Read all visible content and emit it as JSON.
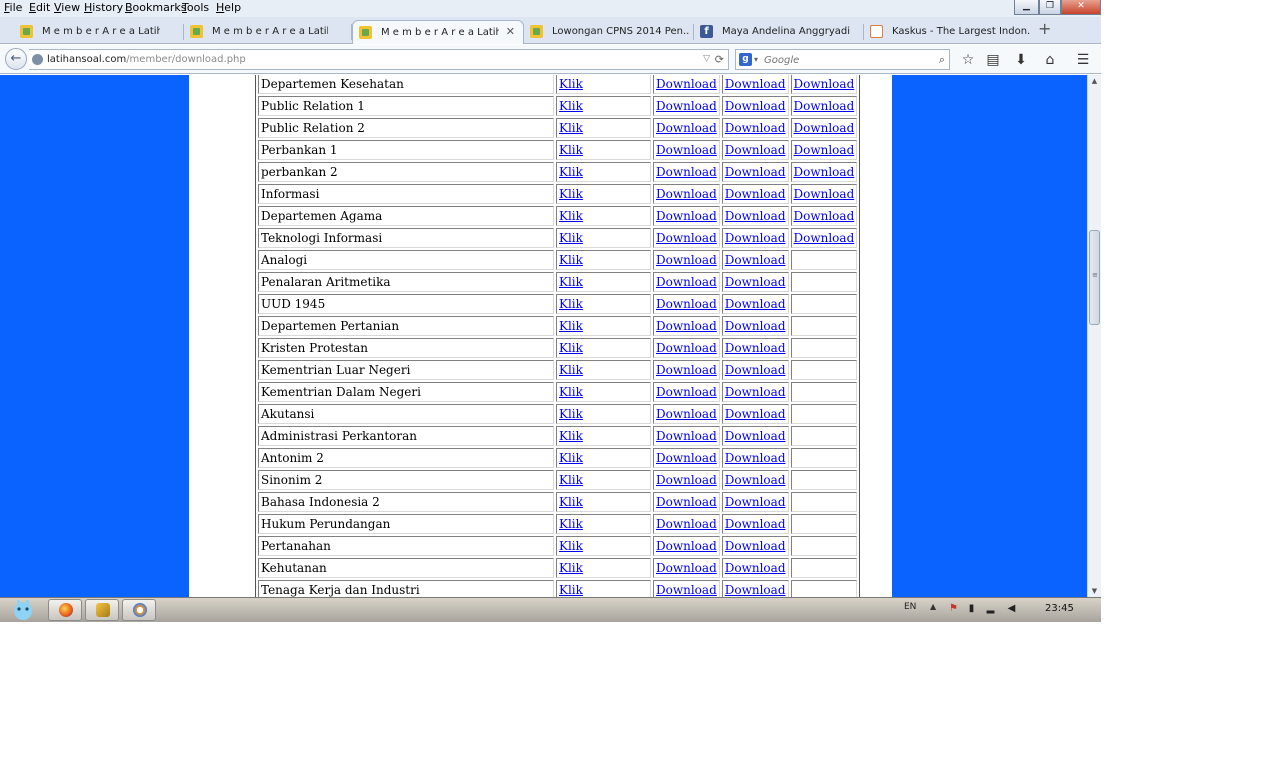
{
  "menubar": {
    "items": [
      "File",
      "Edit",
      "View",
      "History",
      "Bookmarks",
      "Tools",
      "Help"
    ]
  },
  "window_controls": {
    "minimize": "▁",
    "restore": "❐",
    "close": "✕"
  },
  "tabs": [
    {
      "title": "M e m b e r A r e a  Latihan...",
      "favicon": "latihansoal-icon"
    },
    {
      "title": "M e m b e r A r e a  Latihan...",
      "favicon": "latihansoal-icon"
    },
    {
      "title": "M e m b e r A r e a  Latihan...",
      "favicon": "latihansoal-icon",
      "active": true
    },
    {
      "title": "Lowongan CPNS 2014 Pen...",
      "favicon": "latihansoal-icon"
    },
    {
      "title": "Maya Andelina Anggryadi",
      "favicon": "facebook-icon"
    },
    {
      "title": "Kaskus - The Largest Indon...",
      "favicon": "kaskus-icon"
    }
  ],
  "new_tab": "+",
  "navbar": {
    "url_host": "latihansoal.com",
    "url_path": "/member/download.php",
    "search_placeholder": "Google",
    "back": "←",
    "reload": "⟳",
    "dropdown": "▽"
  },
  "colors": {
    "page_background": "#0a63ff",
    "link": "#0000ee"
  },
  "table": {
    "rows": [
      {
        "name": "Departemen Kesehatan",
        "klik": "Klik",
        "d1": "Download",
        "d2": "Download",
        "d3": "Download"
      },
      {
        "name": "Public Relation 1",
        "klik": "Klik",
        "d1": "Download",
        "d2": "Download",
        "d3": "Download"
      },
      {
        "name": "Public Relation 2",
        "klik": "Klik",
        "d1": "Download",
        "d2": "Download",
        "d3": "Download"
      },
      {
        "name": "Perbankan 1",
        "klik": "Klik",
        "d1": "Download",
        "d2": "Download",
        "d3": "Download"
      },
      {
        "name": "perbankan 2",
        "klik": "Klik",
        "d1": "Download",
        "d2": "Download",
        "d3": "Download"
      },
      {
        "name": "Informasi",
        "klik": "Klik",
        "d1": "Download",
        "d2": "Download",
        "d3": "Download"
      },
      {
        "name": "Departemen Agama",
        "klik": "Klik",
        "d1": "Download",
        "d2": "Download",
        "d3": "Download"
      },
      {
        "name": "Teknologi Informasi",
        "klik": "Klik",
        "d1": "Download",
        "d2": "Download",
        "d3": "Download"
      },
      {
        "name": "Analogi",
        "klik": "Klik",
        "d1": "Download",
        "d2": "Download",
        "d3": ""
      },
      {
        "name": "Penalaran Aritmetika",
        "klik": "Klik",
        "d1": "Download",
        "d2": "Download",
        "d3": ""
      },
      {
        "name": "UUD 1945",
        "klik": "Klik",
        "d1": "Download",
        "d2": "Download",
        "d3": ""
      },
      {
        "name": "Departemen Pertanian",
        "klik": "Klik",
        "d1": "Download",
        "d2": "Download",
        "d3": ""
      },
      {
        "name": "Kristen Protestan",
        "klik": "Klik",
        "d1": "Download",
        "d2": "Download",
        "d3": ""
      },
      {
        "name": "Kementrian Luar Negeri",
        "klik": "Klik",
        "d1": "Download",
        "d2": "Download",
        "d3": ""
      },
      {
        "name": "Kementrian Dalam Negeri",
        "klik": "Klik",
        "d1": "Download",
        "d2": "Download",
        "d3": ""
      },
      {
        "name": "Akutansi",
        "klik": "Klik",
        "d1": "Download",
        "d2": "Download",
        "d3": ""
      },
      {
        "name": "Administrasi Perkantoran",
        "klik": "Klik",
        "d1": "Download",
        "d2": "Download",
        "d3": ""
      },
      {
        "name": "Antonim 2",
        "klik": "Klik",
        "d1": "Download",
        "d2": "Download",
        "d3": ""
      },
      {
        "name": "Sinonim 2",
        "klik": "Klik",
        "d1": "Download",
        "d2": "Download",
        "d3": ""
      },
      {
        "name": "Bahasa Indonesia 2",
        "klik": "Klik",
        "d1": "Download",
        "d2": "Download",
        "d3": ""
      },
      {
        "name": "Hukum Perundangan",
        "klik": "Klik",
        "d1": "Download",
        "d2": "Download",
        "d3": ""
      },
      {
        "name": "Pertanahan",
        "klik": "Klik",
        "d1": "Download",
        "d2": "Download",
        "d3": ""
      },
      {
        "name": "Kehutanan",
        "klik": "Klik",
        "d1": "Download",
        "d2": "Download",
        "d3": ""
      },
      {
        "name": "Tenaga Kerja dan Industri",
        "klik": "Klik",
        "d1": "Download",
        "d2": "Download",
        "d3": ""
      }
    ]
  },
  "taskbar": {
    "apps": [
      "firefox-icon",
      "latihansoal-app-icon",
      "paint-icon"
    ],
    "language": "EN",
    "clock": "23:45"
  }
}
